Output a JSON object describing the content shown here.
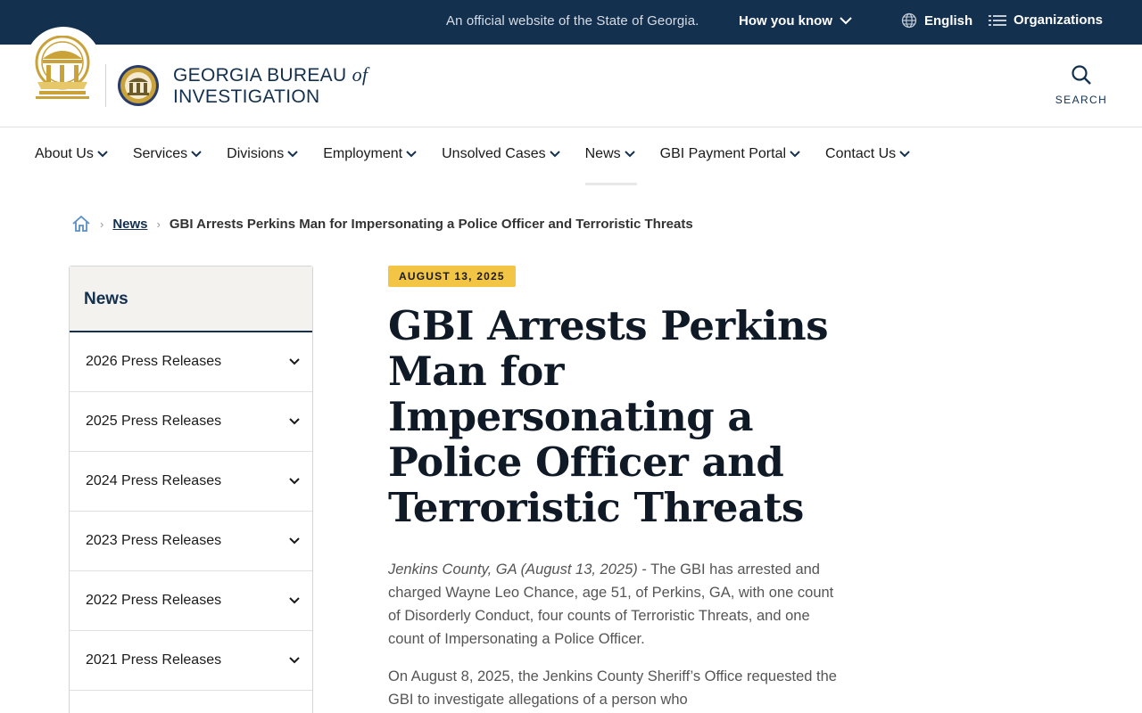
{
  "banner": {
    "official_text": "An official website of the State of Georgia.",
    "how_you_know": "How you know",
    "language": "English",
    "organizations": "Organizations"
  },
  "header": {
    "org_name_line1": "GEORGIA BUREAU",
    "org_name_of": "of",
    "org_name_line2": "INVESTIGATION",
    "search_label": "SEARCH"
  },
  "nav": {
    "items": [
      {
        "label": "About Us"
      },
      {
        "label": "Services"
      },
      {
        "label": "Divisions"
      },
      {
        "label": "Employment"
      },
      {
        "label": "Unsolved Cases"
      },
      {
        "label": "News"
      },
      {
        "label": "GBI Payment Portal"
      },
      {
        "label": "Contact Us"
      }
    ]
  },
  "breadcrumb": {
    "parent": "News",
    "current": "GBI Arrests Perkins Man for Impersonating a Police Officer and Terroristic Threats"
  },
  "sidebar": {
    "title": "News",
    "items": [
      {
        "label": "2026 Press Releases"
      },
      {
        "label": "2025 Press Releases"
      },
      {
        "label": "2024 Press Releases"
      },
      {
        "label": "2023 Press Releases"
      },
      {
        "label": "2022 Press Releases"
      },
      {
        "label": "2021 Press Releases"
      }
    ]
  },
  "article": {
    "date": "AUGUST 13, 2025",
    "title": "GBI Arrests Perkins Man for Impersonating a Police Officer and Terroristic Threats",
    "dateline": "Jenkins County, GA (August 13, 2025)",
    "p1_rest": " - The GBI has arrested and charged Wayne Leo Chance, age 51, of Perkins, GA, with one count of Disorderly Conduct, four counts of Terroristic Threats, and one count of Impersonating a Police Officer.",
    "p2": "On August 8, 2025, the Jenkins County Sheriff’s Office requested the GBI to investigate allegations of a person who"
  },
  "colors": {
    "navy": "#13304e",
    "gold": "#f2c544",
    "seal_gold": "#c9a23a"
  }
}
